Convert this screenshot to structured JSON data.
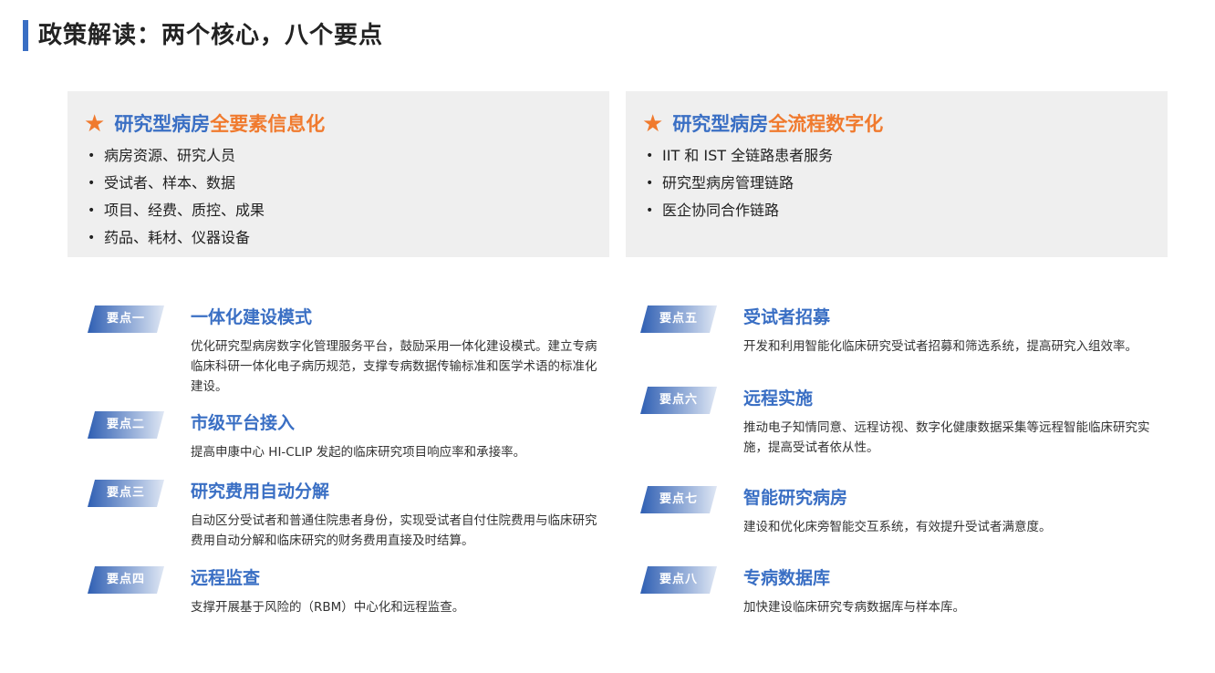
{
  "page_title": "政策解读：两个核心，八个要点",
  "cores": [
    {
      "title_blue": "研究型病房",
      "title_orange": "全要素信息化",
      "items": [
        "病房资源、研究人员",
        "受试者、样本、数据",
        "项目、经费、质控、成果",
        "药品、耗材、仪器设备"
      ]
    },
    {
      "title_blue": "研究型病房",
      "title_orange": "全流程数字化",
      "items": [
        "IIT 和 IST 全链路患者服务",
        "研究型病房管理链路",
        "医企协同合作链路"
      ]
    }
  ],
  "bullet": "•",
  "points": [
    {
      "badge": "要点一",
      "title": "一体化建设模式",
      "desc": "优化研究型病房数字化管理服务平台，鼓励采用一体化建设模式。建立专病临床科研一体化电子病历规范，支撑专病数据传输标准和医学术语的标准化建设。"
    },
    {
      "badge": "要点二",
      "title": "市级平台接入",
      "desc": "提高申康中心 HI-CLIP 发起的临床研究项目响应率和承接率。"
    },
    {
      "badge": "要点三",
      "title": "研究费用自动分解",
      "desc": "自动区分受试者和普通住院患者身份，实现受试者自付住院费用与临床研究费用自动分解和临床研究的财务费用直接及时结算。"
    },
    {
      "badge": "要点四",
      "title": "远程监查",
      "desc": "支撑开展基于风险的（RBM）中心化和远程监查。"
    },
    {
      "badge": "要点五",
      "title": "受试者招募",
      "desc": "开发和利用智能化临床研究受试者招募和筛选系统，提高研究入组效率。"
    },
    {
      "badge": "要点六",
      "title": "远程实施",
      "desc": "推动电子知情同意、远程访视、数字化健康数据采集等远程智能临床研究实施，提高受试者依从性。"
    },
    {
      "badge": "要点七",
      "title": "智能研究病房",
      "desc": "建设和优化床旁智能交互系统，有效提升受试者满意度。"
    },
    {
      "badge": "要点八",
      "title": "专病数据库",
      "desc": "加快建设临床研究专病数据库与样本库。"
    }
  ],
  "colors": {
    "accent_blue": "#3a6fc4",
    "accent_orange": "#f07a2e",
    "box_bg": "#efefef"
  }
}
